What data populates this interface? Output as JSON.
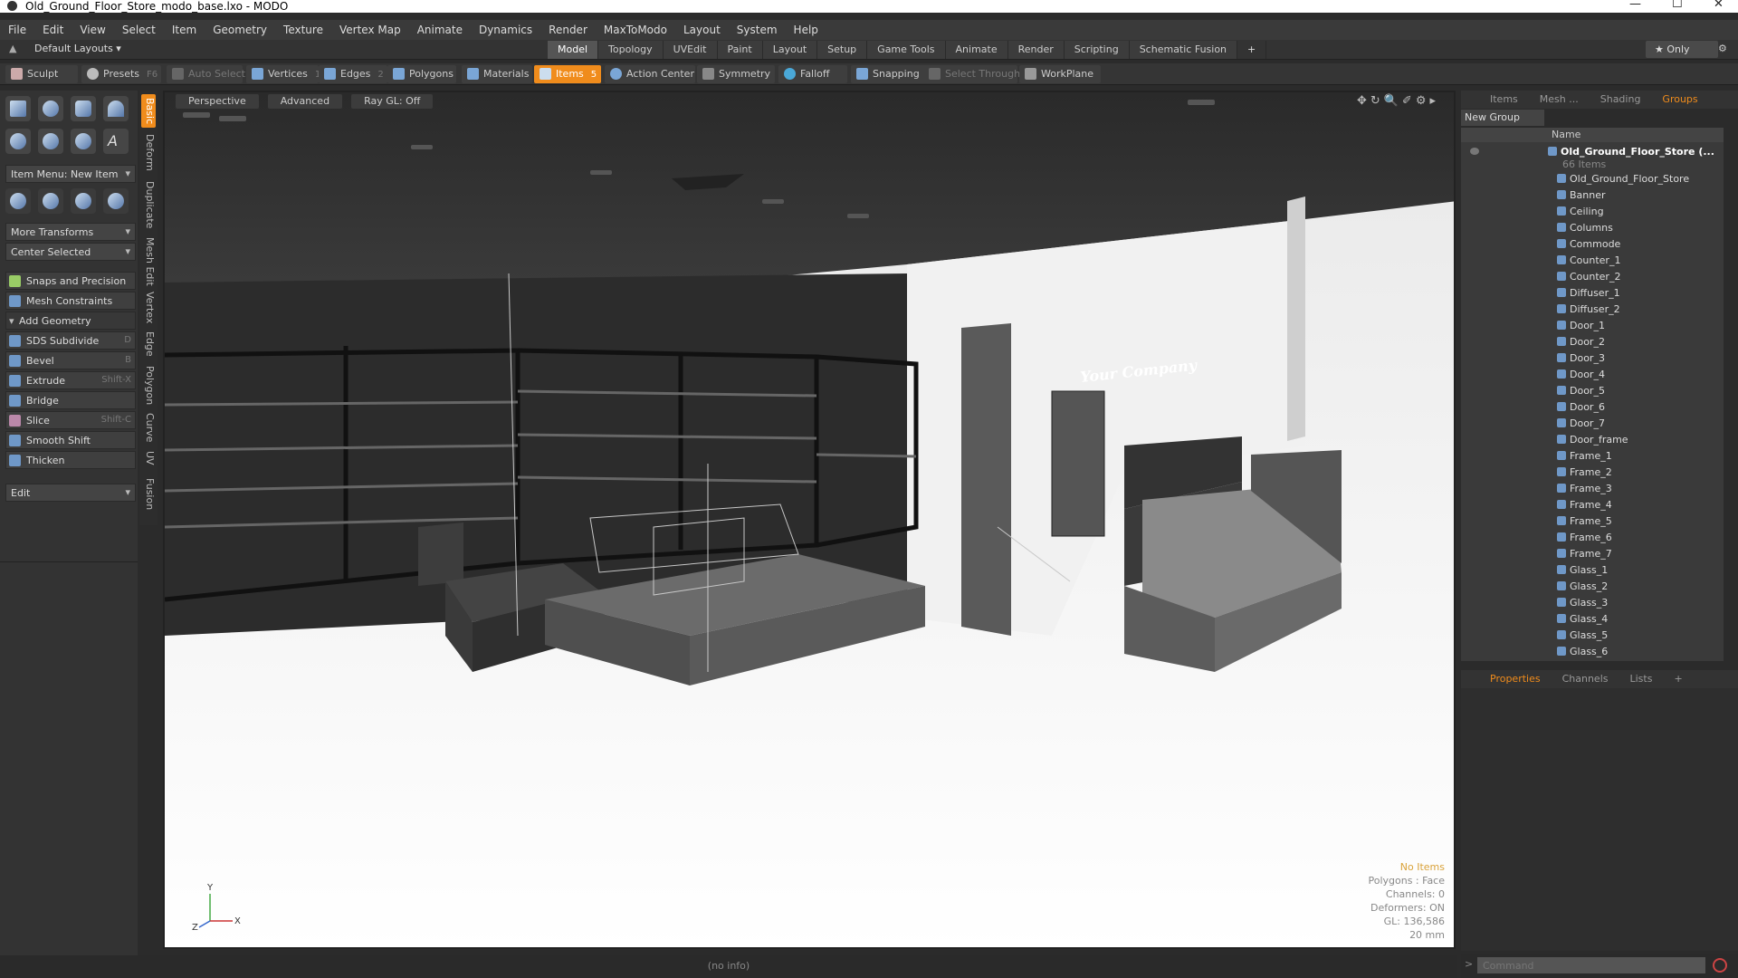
{
  "window": {
    "title": "Old_Ground_Floor_Store_modo_base.lxo - MODO",
    "controls": [
      "—",
      "☐",
      "✕"
    ]
  },
  "menu": [
    "File",
    "Edit",
    "View",
    "Select",
    "Item",
    "Geometry",
    "Texture",
    "Vertex Map",
    "Animate",
    "Dynamics",
    "Render",
    "MaxToModo",
    "Layout",
    "System",
    "Help"
  ],
  "layout": {
    "preset": "Default Layouts ▾",
    "tabs": [
      "Model",
      "Topology",
      "UVEdit",
      "Paint",
      "Layout",
      "Setup",
      "Game Tools",
      "Animate",
      "Render",
      "Scripting",
      "Schematic Fusion"
    ],
    "active_tab": "Model",
    "add": "+",
    "only": "★ Only",
    "gear": "⚙"
  },
  "toolbar": {
    "sculpt": "Sculpt",
    "presets": "Presets",
    "presets_sc": "F6",
    "auto_select": "Auto Select",
    "vertices": "Vertices",
    "vertices_n": "1",
    "edges": "Edges",
    "edges_n": "2",
    "polygons": "Polygons",
    "materials": "Materials",
    "items": "Items",
    "items_n": "5",
    "action_center": "Action Center",
    "symmetry": "Symmetry",
    "falloff": "Falloff",
    "snapping": "Snapping",
    "select_through": "Select Through",
    "workplane": "WorkPlane"
  },
  "left": {
    "item_menu": "Item Menu: New Item",
    "more_transforms": "More Transforms",
    "center_selected": "Center Selected",
    "snaps": "Snaps and Precision",
    "mesh_constraints": "Mesh Constraints",
    "add_geometry": "Add Geometry",
    "tools": [
      {
        "label": "SDS Subdivide",
        "sc": "D"
      },
      {
        "label": "Bevel",
        "sc": "B"
      },
      {
        "label": "Extrude",
        "sc": "Shift-X"
      },
      {
        "label": "Bridge",
        "sc": ""
      },
      {
        "label": "Slice",
        "sc": "Shift-C"
      },
      {
        "label": "Smooth Shift",
        "sc": ""
      },
      {
        "label": "Thicken",
        "sc": ""
      }
    ],
    "edit": "Edit"
  },
  "vtabs": [
    "Basic",
    "Deform",
    "Duplicate",
    "Mesh Edit",
    "Vertex",
    "Edge",
    "Polygon",
    "Curve",
    "UV",
    "Fusion"
  ],
  "viewport": {
    "mode": "Perspective",
    "shading": "Advanced",
    "raygl": "Ray GL: Off",
    "sign": "Your Company",
    "hud": {
      "items": "No Items",
      "polygons": "Polygons : Face",
      "channels": "Channels: 0",
      "deformers": "Deformers: ON",
      "gl": "GL: 136,586",
      "scale": "20 mm"
    },
    "axes": {
      "y": "Y",
      "x": "X",
      "z": "Z"
    }
  },
  "status": "(no info)",
  "right": {
    "tabs": [
      "Items",
      "Mesh ...",
      "Shading",
      "Groups"
    ],
    "active_tab": "Groups",
    "new_group": "New Group",
    "name_header": "Name",
    "group": {
      "name": "Old_Ground_Floor_Store (...",
      "count": "66 Items"
    },
    "items": [
      "Old_Ground_Floor_Store",
      "Banner",
      "Ceiling",
      "Columns",
      "Commode",
      "Counter_1",
      "Counter_2",
      "Diffuser_1",
      "Diffuser_2",
      "Door_1",
      "Door_2",
      "Door_3",
      "Door_4",
      "Door_5",
      "Door_6",
      "Door_7",
      "Door_frame",
      "Frame_1",
      "Frame_2",
      "Frame_3",
      "Frame_4",
      "Frame_5",
      "Frame_6",
      "Frame_7",
      "Glass_1",
      "Glass_2",
      "Glass_3",
      "Glass_4",
      "Glass_5",
      "Glass_6"
    ],
    "prop_tabs": [
      "Properties",
      "Channels",
      "Lists",
      "+"
    ],
    "active_prop": "Properties",
    "command_placeholder": "Command"
  },
  "colors": {
    "accent": "#f08c1c",
    "panel": "#333333",
    "viewport_floor": "#f4f4f4"
  }
}
